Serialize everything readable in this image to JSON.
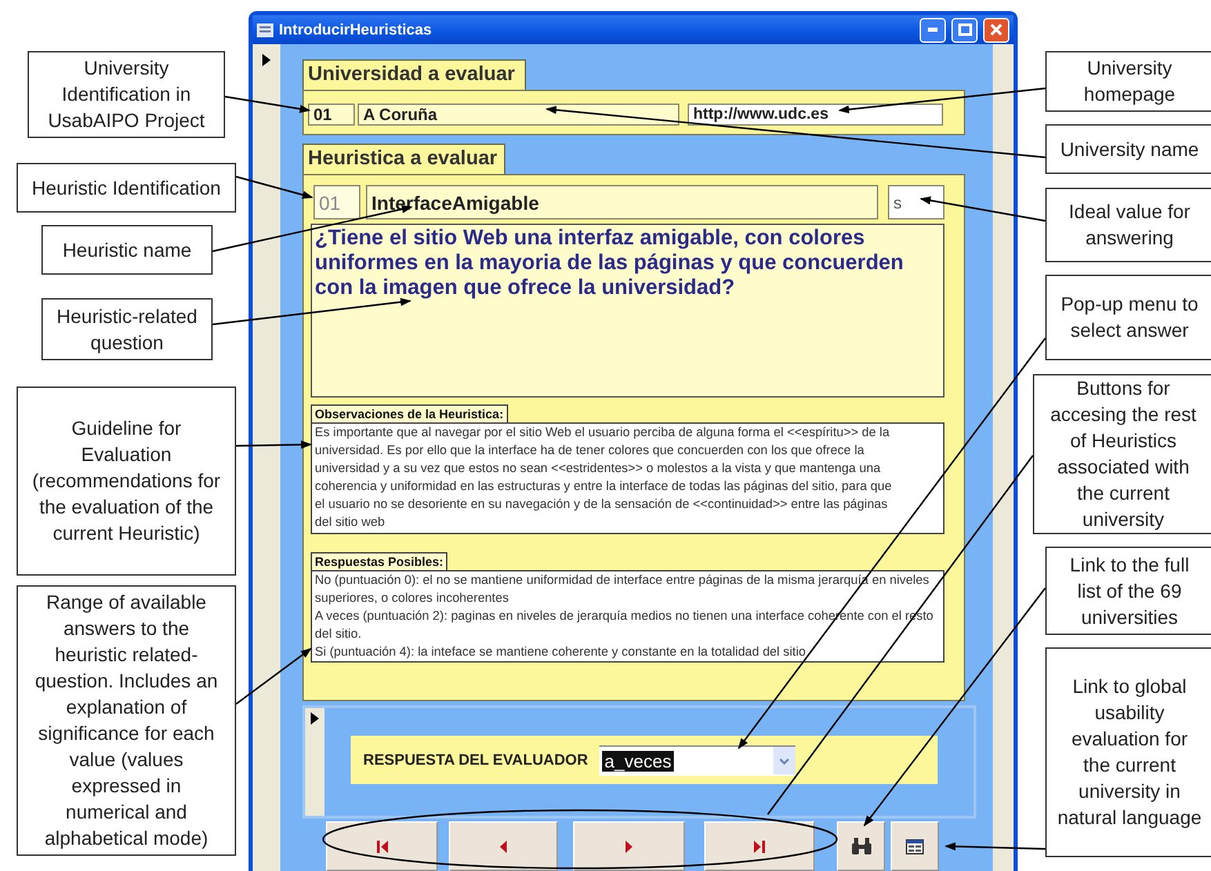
{
  "window": {
    "title": "IntroducirHeuristicas"
  },
  "university_section": {
    "heading": "Universidad a evaluar",
    "id": "01",
    "name": "A Coruña",
    "homepage": "http://www.udc.es"
  },
  "heuristic_section": {
    "heading": "Heuristica a evaluar",
    "id": "01",
    "name": "InterfaceAmigable",
    "ideal_value": "s",
    "question": "¿Tiene el sitio Web una interfaz amigable, con colores uniformes en la mayoria de las páginas y que concuerden con la imagen que ofrece la universidad?",
    "observations_label": "Observaciones de la Heuristica:",
    "observations": "Es importante que al navegar por el sitio Web el usuario perciba de alguna forma el <<espíritu>> de la universidad. Es por ello que la interface ha de tener colores que concuerden con los que ofrece la universidad y a su vez que estos no sean <<estridentes>> o molestos a la vista y que mantenga una coherencia y uniformidad en las estructuras y entre la interface de todas las páginas del sitio, para que el usuario no se desoriente en su navegación y de la sensación de <<continuidad>> entre las páginas del sitio web",
    "answers_label": "Respuestas Posibles:",
    "answers": [
      "No (puntuación 0): el no se mantiene uniformidad de interface entre páginas de la misma jerarquía en niveles superiores, o colores incoherentes",
      "A veces (puntuación 2): paginas en niveles de jerarquía medios no tienen una interface coherente con el resto del sitio.",
      "Si (puntuación 4): la inteface se mantiene coherente y constante en la totalidad del sitio"
    ]
  },
  "evaluator": {
    "label": "RESPUESTA DEL EVALUADOR",
    "value": "a_veces"
  },
  "nav_buttons": [
    {
      "kind": "first"
    },
    {
      "kind": "previous"
    },
    {
      "kind": "next"
    },
    {
      "kind": "last"
    },
    {
      "kind": "search"
    },
    {
      "kind": "form"
    }
  ],
  "callouts": {
    "left": [
      "University Identification in UsabAIPO Project",
      "Heuristic Identification",
      "Heuristic name",
      "Heuristic-related question",
      "Guideline for Evaluation (recommendations for the evaluation of the current Heuristic)",
      "Range of available answers to  the heuristic related-question. Includes an explanation of significance for each value (values expressed in numerical and alphabetical mode)"
    ],
    "right": [
      "University homepage",
      "University name",
      "Ideal value for answering",
      "Pop-up menu to select answer",
      "Buttons for accesing the rest of Heuristics associated with the current university",
      "Link to the full list of the 69 universities",
      "Link to global usability evaluation for the current university in natural language"
    ]
  }
}
